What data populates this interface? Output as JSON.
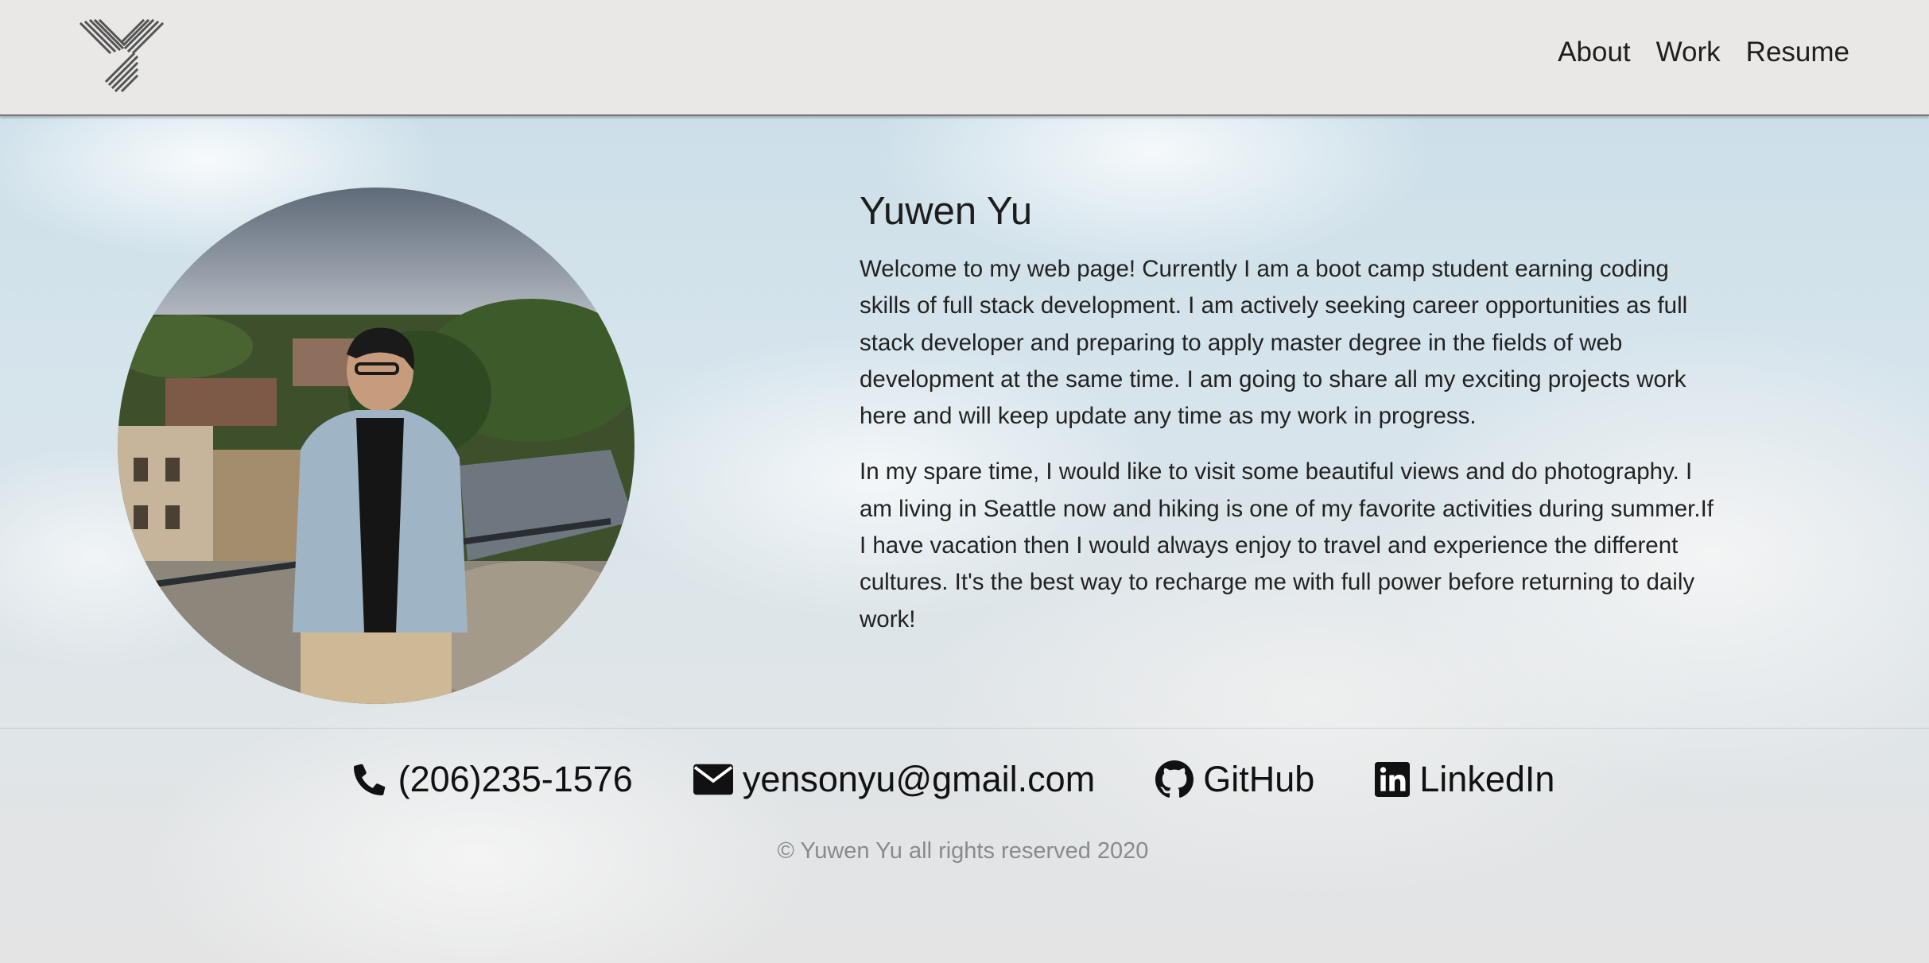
{
  "nav": {
    "links": [
      "About",
      "Work",
      "Resume"
    ]
  },
  "profile": {
    "name": "Yuwen Yu",
    "paragraphs": [
      "Welcome to my web page! Currently I am a boot camp student earning coding skills of full stack development. I am actively seeking career opportunities as full stack developer and preparing to apply master degree in the fields of web development at the same time. I am going to share all my exciting projects work here and will keep update any time as my work in progress.",
      "In my spare time, I would like to visit some beautiful views and do photography. I am living in Seattle now and hiking is one of my favorite activities during summer.If I have vacation then I would always enjoy to travel and experience the different cultures. It's the best way to recharge me with full power before returning to daily work!"
    ]
  },
  "contacts": {
    "phone": "(206)235-1576",
    "email": "yensonyu@gmail.com",
    "github": "GitHub",
    "linkedin": "LinkedIn"
  },
  "icons": {
    "logo": "striped-y-logo",
    "phone": "phone-icon",
    "email": "envelope-icon",
    "github": "github-icon",
    "linkedin": "linkedin-icon"
  },
  "footer": {
    "copyright": "© Yuwen Yu all rights reserved 2020"
  },
  "colors": {
    "navbar_bg": "#e9e8e7",
    "text": "#1d1d1d",
    "muted_text": "#8a8a8a"
  }
}
